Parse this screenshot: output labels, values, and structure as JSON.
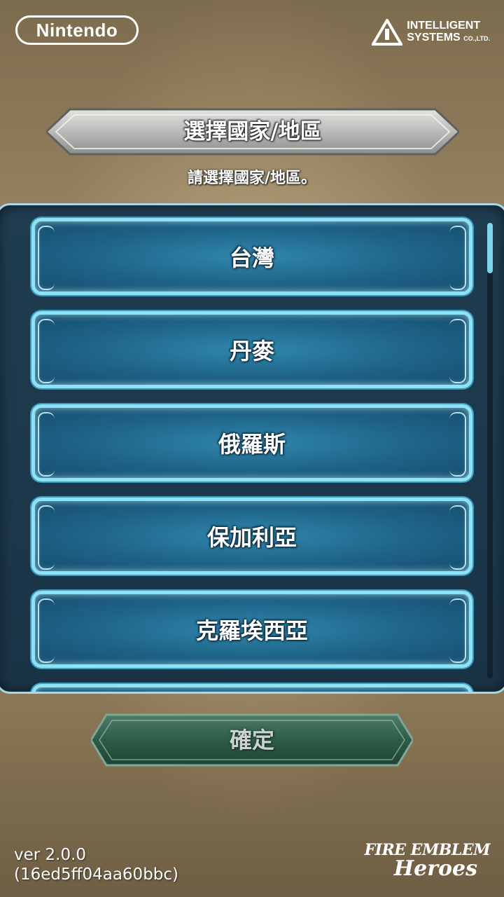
{
  "header": {
    "nintendo_logo": "Nintendo",
    "developer_logo_line1": "INTELLIGENT",
    "developer_logo_line2": "SYSTEMS",
    "developer_logo_suffix": "CO.,LTD."
  },
  "dialog": {
    "title": "選擇國家/地區",
    "subtitle": "請選擇國家/地區。"
  },
  "countries": [
    {
      "label": "台灣"
    },
    {
      "label": "丹麥"
    },
    {
      "label": "俄羅斯"
    },
    {
      "label": "保加利亞"
    },
    {
      "label": "克羅埃西亞"
    }
  ],
  "scroll": {
    "position_fraction": 0.0,
    "visible_fraction": 0.11
  },
  "confirm_button": {
    "label": "確定",
    "enabled": false
  },
  "footer": {
    "version": "ver 2.0.0",
    "build": "(16ed5ff04aa60bbc)",
    "game_logo_line1": "FIRE EMBLEM",
    "game_logo_line2": "Heroes"
  },
  "colors": {
    "list_button_border": "#8fe2f3",
    "list_button_fill": "#1f6388",
    "panel_bg": "#1f3d50",
    "confirm_fill": "#2d5c48"
  }
}
